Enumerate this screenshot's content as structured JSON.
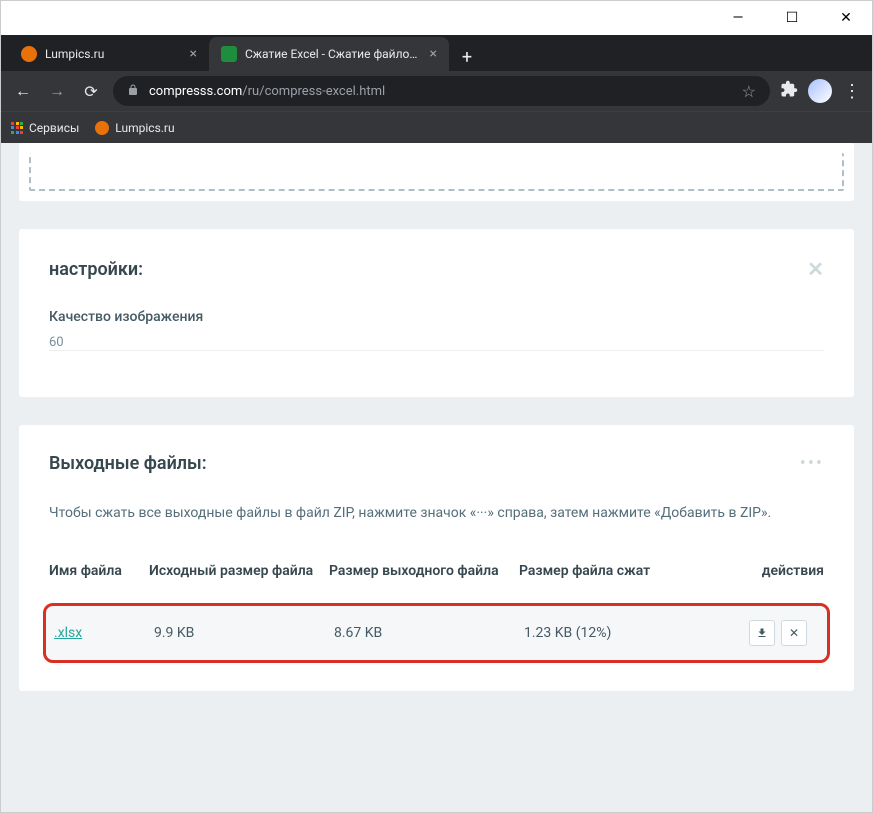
{
  "window": {
    "minimize": "—",
    "maximize": "☐",
    "close": "✕"
  },
  "tabs": [
    {
      "title": "Lumpics.ru",
      "favicon": "orange",
      "active": false
    },
    {
      "title": "Сжатие Excel - Сжатие файлов X",
      "favicon": "green",
      "active": true
    }
  ],
  "url": {
    "domain": "compresss.com",
    "path": "/ru/compress-excel.html"
  },
  "bookmarks": {
    "apps": "Сервисы",
    "lumpics": "Lumpics.ru"
  },
  "settings": {
    "title": "настройки:",
    "quality_label": "Качество изображения",
    "quality_value": "60"
  },
  "output": {
    "title": "Выходные файлы:",
    "help": "Чтобы сжать все выходные файлы в файл ZIP, нажмите значок «···» справа, затем нажмите «Добавить в ZIP».",
    "headers": {
      "name": "Имя файла",
      "orig": "Исходный размер файла",
      "out": "Размер выходного файла",
      "comp": "Размер файла сжат",
      "actions": "действия"
    },
    "rows": [
      {
        "name": ".xlsx",
        "orig": "9.9 KB",
        "out": "8.67 KB",
        "comp": "1.23 KB (12%)"
      }
    ]
  }
}
